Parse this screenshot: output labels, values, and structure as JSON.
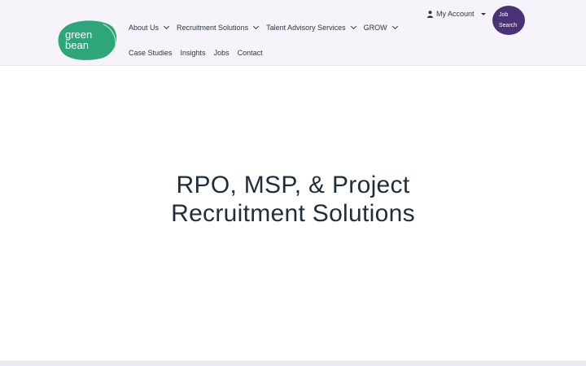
{
  "brand": {
    "logo_text_line1": "green",
    "logo_text_line2": "bean",
    "logo_color": "#2fa57a"
  },
  "nav": {
    "primary": [
      {
        "label": "About Us",
        "has_dropdown": true
      },
      {
        "label": "Recruitment Solutions",
        "has_dropdown": true
      },
      {
        "label": "Talent Advisory Services",
        "has_dropdown": true
      },
      {
        "label": "GROW",
        "has_dropdown": true
      }
    ],
    "secondary": [
      {
        "label": "Case Studies"
      },
      {
        "label": "Insights"
      },
      {
        "label": "Jobs"
      },
      {
        "label": "Contact"
      }
    ]
  },
  "account": {
    "label": "My Account",
    "icon": "person-icon"
  },
  "job_search": {
    "line1": "Job",
    "line2": "Search",
    "color": "#4a3277"
  },
  "hero": {
    "line1": "RPO, MSP, & Project",
    "line2": "Recruitment Solutions"
  }
}
